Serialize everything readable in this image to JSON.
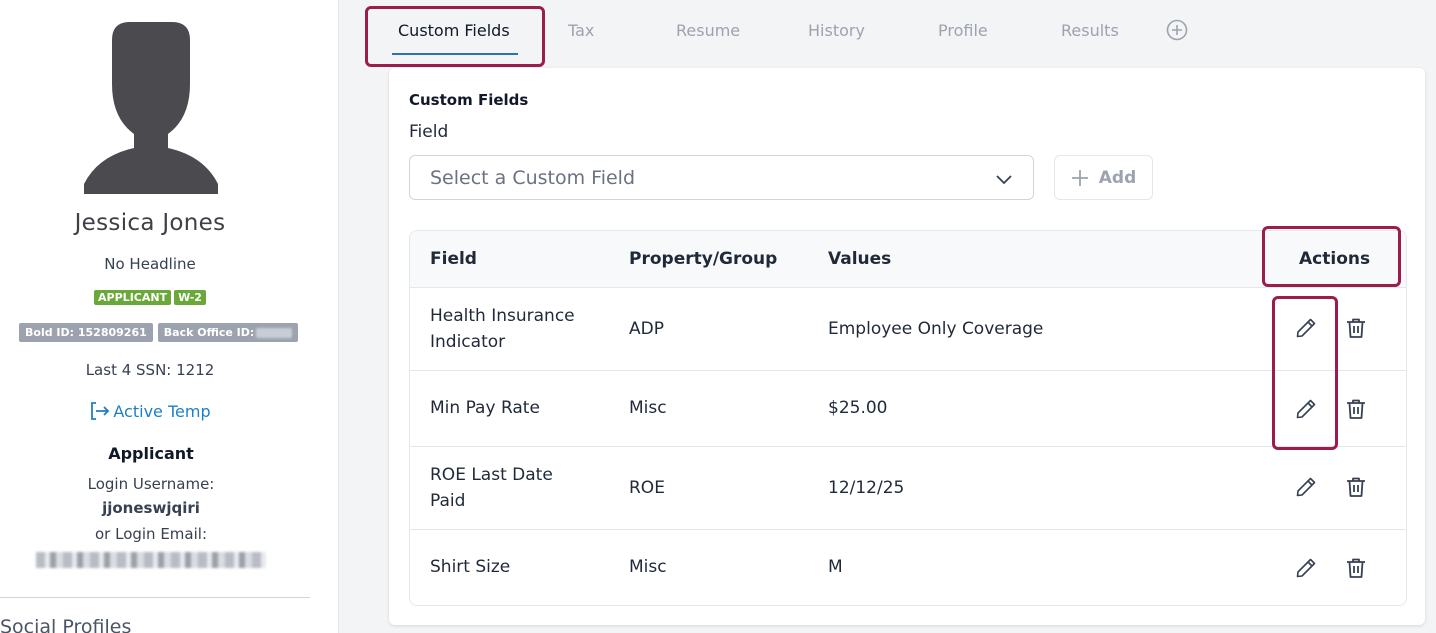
{
  "profile": {
    "name": "Jessica Jones",
    "headline": "No Headline",
    "tags": [
      "APPLICANT",
      "W-2"
    ],
    "bold_id_label": "Bold ID: 152809261",
    "back_office_label": "Back Office ID:",
    "ssn_label": "Last 4 SSN: 1212",
    "status": "Active Temp",
    "role": "Applicant",
    "login_username_label": "Login Username:",
    "login_username": "jjoneswjqiri",
    "login_email_label": "or Login Email:",
    "social_heading": "Social Profiles"
  },
  "tabs": [
    {
      "label": "Custom Fields",
      "active": true
    },
    {
      "label": "Tax",
      "active": false
    },
    {
      "label": "Resume",
      "active": false
    },
    {
      "label": "History",
      "active": false
    },
    {
      "label": "Profile",
      "active": false
    },
    {
      "label": "Results",
      "active": false
    }
  ],
  "custom_fields": {
    "title": "Custom Fields",
    "field_label": "Field",
    "select_placeholder": "Select a Custom Field",
    "add_label": "Add",
    "columns": {
      "field": "Field",
      "property": "Property/Group",
      "values": "Values",
      "actions": "Actions"
    },
    "rows": [
      {
        "field": "Health Insurance Indicator",
        "property": "ADP",
        "value": "Employee Only Coverage"
      },
      {
        "field": "Min Pay Rate",
        "property": "Misc",
        "value": "$25.00"
      },
      {
        "field": "ROE Last Date Paid",
        "property": "ROE",
        "value": "12/12/25"
      },
      {
        "field": "Shirt Size",
        "property": "Misc",
        "value": "M"
      }
    ]
  },
  "colors": {
    "highlight": "#9b1c4d",
    "tag_green": "#6aa83a",
    "link_blue": "#1d7fc7",
    "tab_underline": "#2f6fb3"
  },
  "icons": [
    "user-avatar-icon",
    "sign-in-arrow-icon",
    "add-tab-icon",
    "chevron-down-icon",
    "plus-icon",
    "edit-pencil-icon",
    "trash-icon"
  ]
}
